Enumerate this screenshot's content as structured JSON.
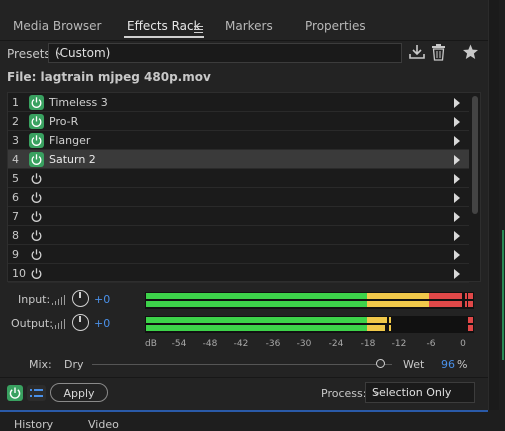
{
  "tabs": [
    {
      "label": "Media Browser"
    },
    {
      "label": "Effects Rack"
    },
    {
      "label": "Markers"
    },
    {
      "label": "Properties"
    }
  ],
  "presets": {
    "label": "Presets:",
    "value": "(Custom)"
  },
  "file": {
    "label": "File: lagtrain mjpeg 480p.mov"
  },
  "slots": [
    {
      "num": "1",
      "name": "Timeless 3",
      "on": true
    },
    {
      "num": "2",
      "name": "Pro-R",
      "on": true
    },
    {
      "num": "3",
      "name": "Flanger",
      "on": true
    },
    {
      "num": "4",
      "name": "Saturn 2",
      "on": true,
      "selected": true
    },
    {
      "num": "5",
      "name": "",
      "on": false
    },
    {
      "num": "6",
      "name": "",
      "on": false
    },
    {
      "num": "7",
      "name": "",
      "on": false
    },
    {
      "num": "8",
      "name": "",
      "on": false
    },
    {
      "num": "9",
      "name": "",
      "on": false
    },
    {
      "num": "10",
      "name": "",
      "on": false
    }
  ],
  "input": {
    "label": "Input:",
    "gain": "+0"
  },
  "output": {
    "label": "Output:",
    "gain": "+0"
  },
  "meter_scale": [
    "dB",
    "-54",
    "-48",
    "-42",
    "-36",
    "-30",
    "-24",
    "-18",
    "-12",
    "-6",
    "0"
  ],
  "mix": {
    "label": "Mix:",
    "dry": "Dry",
    "wet": "Wet",
    "value": "96",
    "unit": "%",
    "fraction": 0.96
  },
  "bottom": {
    "apply": "Apply",
    "process_label": "Process:",
    "process_value": "Selection Only"
  },
  "next_panel": {
    "tabs": [
      "History",
      "Video"
    ]
  },
  "colors": {
    "accent": "#4a90e8",
    "power_on": "#39a160",
    "meter_green": "#3dd34a",
    "meter_yellow": "#f0c84a",
    "meter_red": "#e04848"
  }
}
